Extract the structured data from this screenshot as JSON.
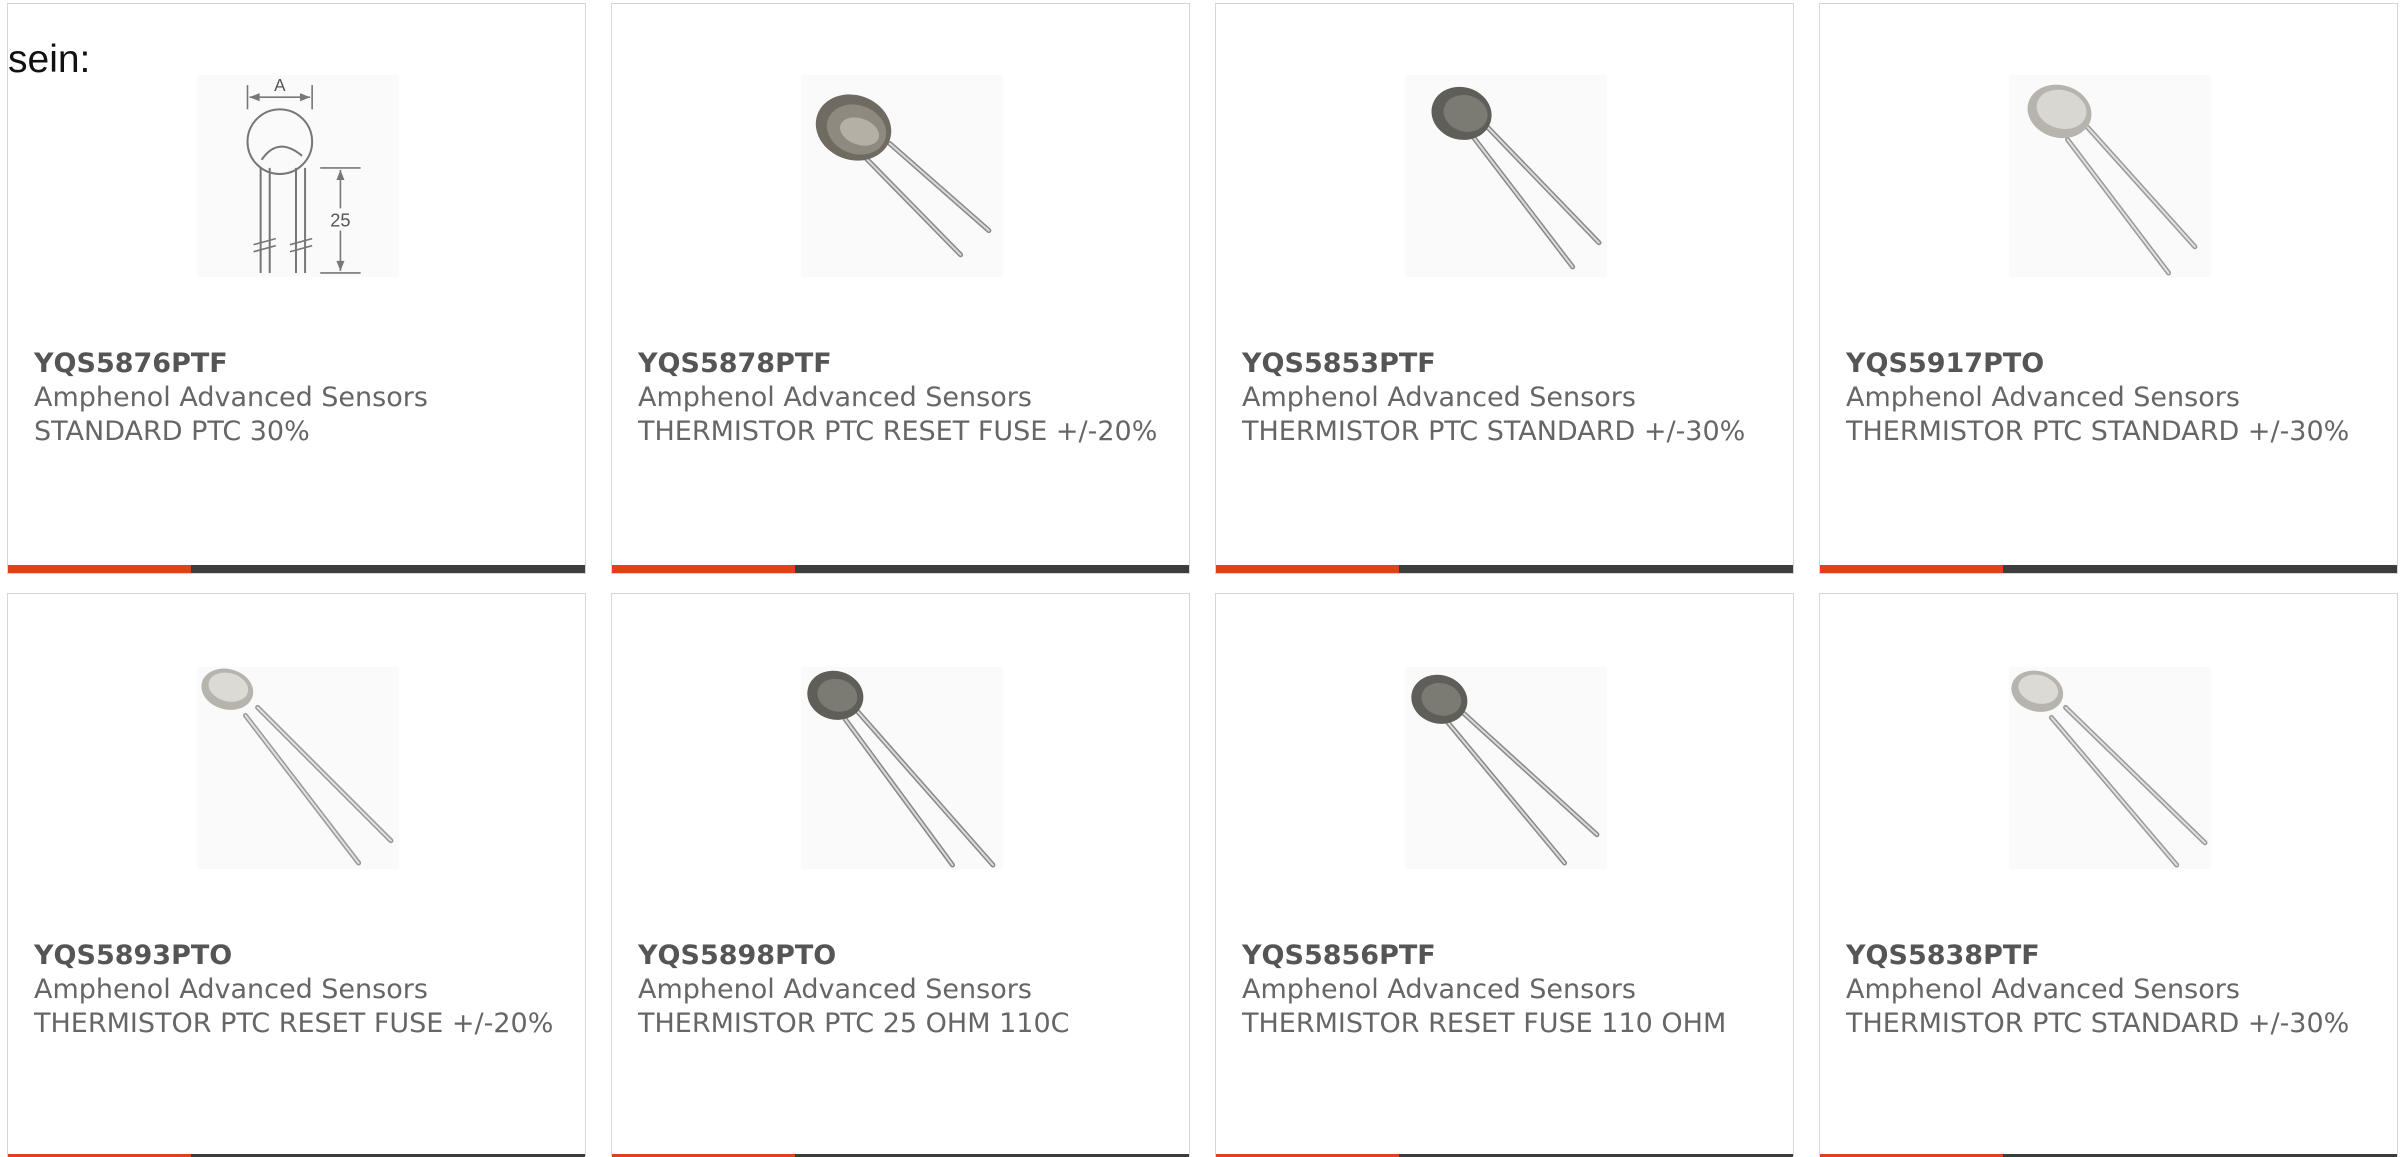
{
  "intro_text": "sein:",
  "colors": {
    "accent": "#e0401c",
    "bar_dark": "#3d3d3d",
    "text": "#666666",
    "border": "#d6d6d6"
  },
  "products": [
    {
      "part": "YQS5876PTF",
      "manufacturer": "Amphenol Advanced Sensors",
      "description": "STANDARD PTC 30%",
      "image": "dimension-drawing",
      "drawing_labels": {
        "width": "A",
        "length": "25"
      }
    },
    {
      "part": "YQS5878PTF",
      "manufacturer": "Amphenol Advanced Sensors",
      "description": "THERMISTOR PTC RESET FUSE +/-20%",
      "image": "thermistor-photo-dark-large"
    },
    {
      "part": "YQS5853PTF",
      "manufacturer": "Amphenol Advanced Sensors",
      "description": "THERMISTOR PTC STANDARD +/-30%",
      "image": "thermistor-photo-dark"
    },
    {
      "part": "YQS5917PTO",
      "manufacturer": "Amphenol Advanced Sensors",
      "description": "THERMISTOR PTC STANDARD +/-30%",
      "image": "thermistor-photo-light"
    },
    {
      "part": "YQS5893PTO",
      "manufacturer": "Amphenol Advanced Sensors",
      "description": "THERMISTOR PTC RESET FUSE +/-20%",
      "image": "thermistor-photo-light"
    },
    {
      "part": "YQS5898PTO",
      "manufacturer": "Amphenol Advanced Sensors",
      "description": "THERMISTOR PTC 25 OHM 110C",
      "image": "thermistor-photo-dark"
    },
    {
      "part": "YQS5856PTF",
      "manufacturer": "Amphenol Advanced Sensors",
      "description": "THERMISTOR RESET FUSE 110 OHM",
      "image": "thermistor-photo-dark"
    },
    {
      "part": "YQS5838PTF",
      "manufacturer": "Amphenol Advanced Sensors",
      "description": "THERMISTOR PTC STANDARD +/-30%",
      "image": "thermistor-photo-light"
    }
  ]
}
